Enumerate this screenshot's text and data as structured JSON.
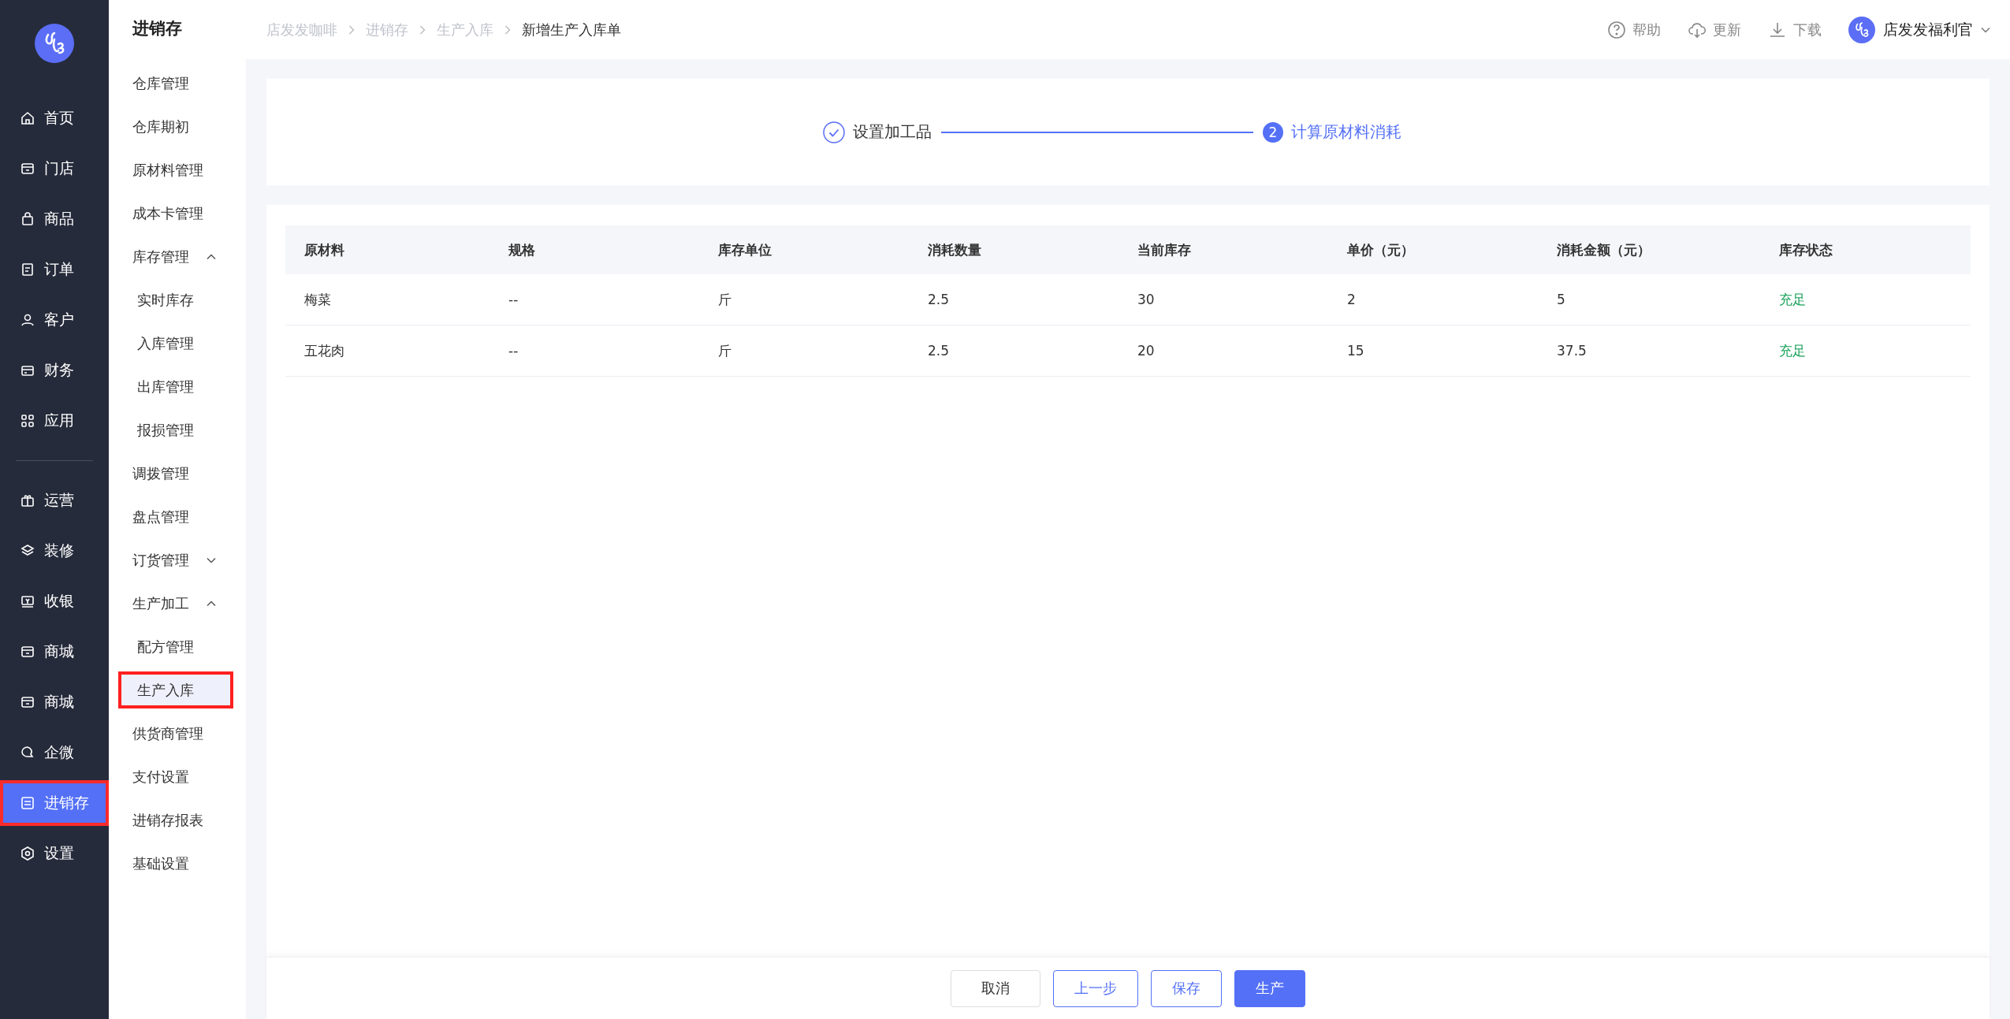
{
  "main_nav": {
    "groups": [
      [
        {
          "label": "首页",
          "selected": false
        },
        {
          "label": "门店",
          "selected": false
        },
        {
          "label": "商品",
          "selected": false
        },
        {
          "label": "订单",
          "selected": false
        },
        {
          "label": "客户",
          "selected": false
        },
        {
          "label": "财务",
          "selected": false
        },
        {
          "label": "应用",
          "selected": false
        }
      ],
      [
        {
          "label": "运营",
          "selected": false
        },
        {
          "label": "装修",
          "selected": false
        },
        {
          "label": "收银",
          "selected": false
        },
        {
          "label": "商城",
          "selected": false
        },
        {
          "label": "商城",
          "selected": false
        },
        {
          "label": "企微",
          "selected": false
        },
        {
          "label": "进销存",
          "selected": true
        },
        {
          "label": "设置",
          "selected": false
        }
      ]
    ]
  },
  "sub_nav": {
    "title": "进销存",
    "items": [
      {
        "kind": "link",
        "label": "仓库管理",
        "selected": false
      },
      {
        "kind": "link",
        "label": "仓库期初",
        "selected": false
      },
      {
        "kind": "link",
        "label": "原材料管理",
        "selected": false
      },
      {
        "kind": "link",
        "label": "成本卡管理",
        "selected": false
      },
      {
        "kind": "group",
        "label": "库存管理",
        "expanded": true,
        "children": [
          {
            "label": "实时库存",
            "selected": false
          },
          {
            "label": "入库管理",
            "selected": false
          },
          {
            "label": "出库管理",
            "selected": false
          },
          {
            "label": "报损管理",
            "selected": false
          }
        ]
      },
      {
        "kind": "link",
        "label": "调拨管理",
        "selected": false
      },
      {
        "kind": "link",
        "label": "盘点管理",
        "selected": false
      },
      {
        "kind": "group",
        "label": "订货管理",
        "expanded": false
      },
      {
        "kind": "group",
        "label": "生产加工",
        "expanded": true,
        "children": [
          {
            "label": "配方管理",
            "selected": false
          },
          {
            "label": "生产入库",
            "selected": true
          }
        ]
      },
      {
        "kind": "link",
        "label": "供货商管理",
        "selected": false
      },
      {
        "kind": "link",
        "label": "支付设置",
        "selected": false
      },
      {
        "kind": "link",
        "label": "进销存报表",
        "selected": false
      },
      {
        "kind": "link",
        "label": "基础设置",
        "selected": false
      }
    ]
  },
  "breadcrumb": [
    "店发发咖啡",
    "进销存",
    "生产入库",
    "新增生产入库单"
  ],
  "header_actions": [
    "帮助",
    "更新",
    "下载"
  ],
  "user": {
    "name": "店发发福利官"
  },
  "steps": [
    {
      "label": "设置加工品",
      "done": true,
      "selected": false
    },
    {
      "number": "2",
      "label": "计算原材料消耗",
      "done": false,
      "selected": true
    }
  ],
  "table": {
    "columns": [
      "原材料",
      "规格",
      "库存单位",
      "消耗数量",
      "当前库存",
      "单价（元）",
      "消耗金额（元）",
      "库存状态"
    ],
    "rows": [
      [
        "梅菜",
        "--",
        "斤",
        "2.5",
        "30",
        "2",
        "5",
        "充足"
      ],
      [
        "五花肉",
        "--",
        "斤",
        "2.5",
        "20",
        "15",
        "37.5",
        "充足"
      ]
    ]
  },
  "buttons": [
    {
      "kind": "default",
      "label": "取消"
    },
    {
      "kind": "outline",
      "label": "上一步"
    },
    {
      "kind": "outline",
      "label": "保存"
    },
    {
      "kind": "primary",
      "label": "生产"
    }
  ]
}
